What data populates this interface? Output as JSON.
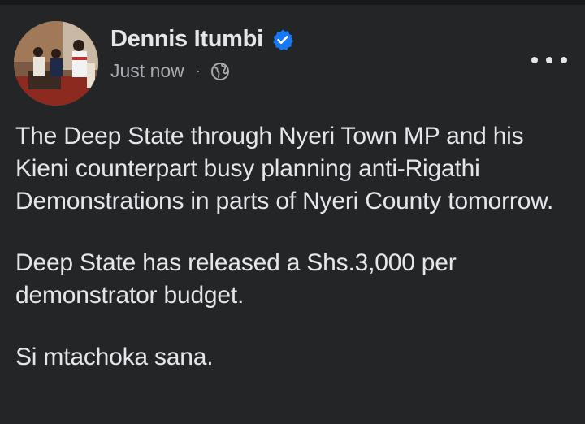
{
  "post": {
    "author": "Dennis Itumbi",
    "timestamp": "Just now",
    "separator": "·",
    "audience_icon": "globe-icon",
    "verified_icon": "verified-badge-icon",
    "more_icon": "more-options-icon",
    "paragraphs": [
      "The Deep State through Nyeri Town MP and his Kieni counterpart busy planning anti-Rigathi Demonstrations in parts of Nyeri County tomorrow.",
      "Deep State has released a Shs.3,000 per demonstrator budget.",
      "Si mtachoka sana."
    ]
  },
  "colors": {
    "background": "#242526",
    "text": "#e4e6eb",
    "secondary_text": "#a8aab0",
    "verified_blue": "#1877f2"
  }
}
